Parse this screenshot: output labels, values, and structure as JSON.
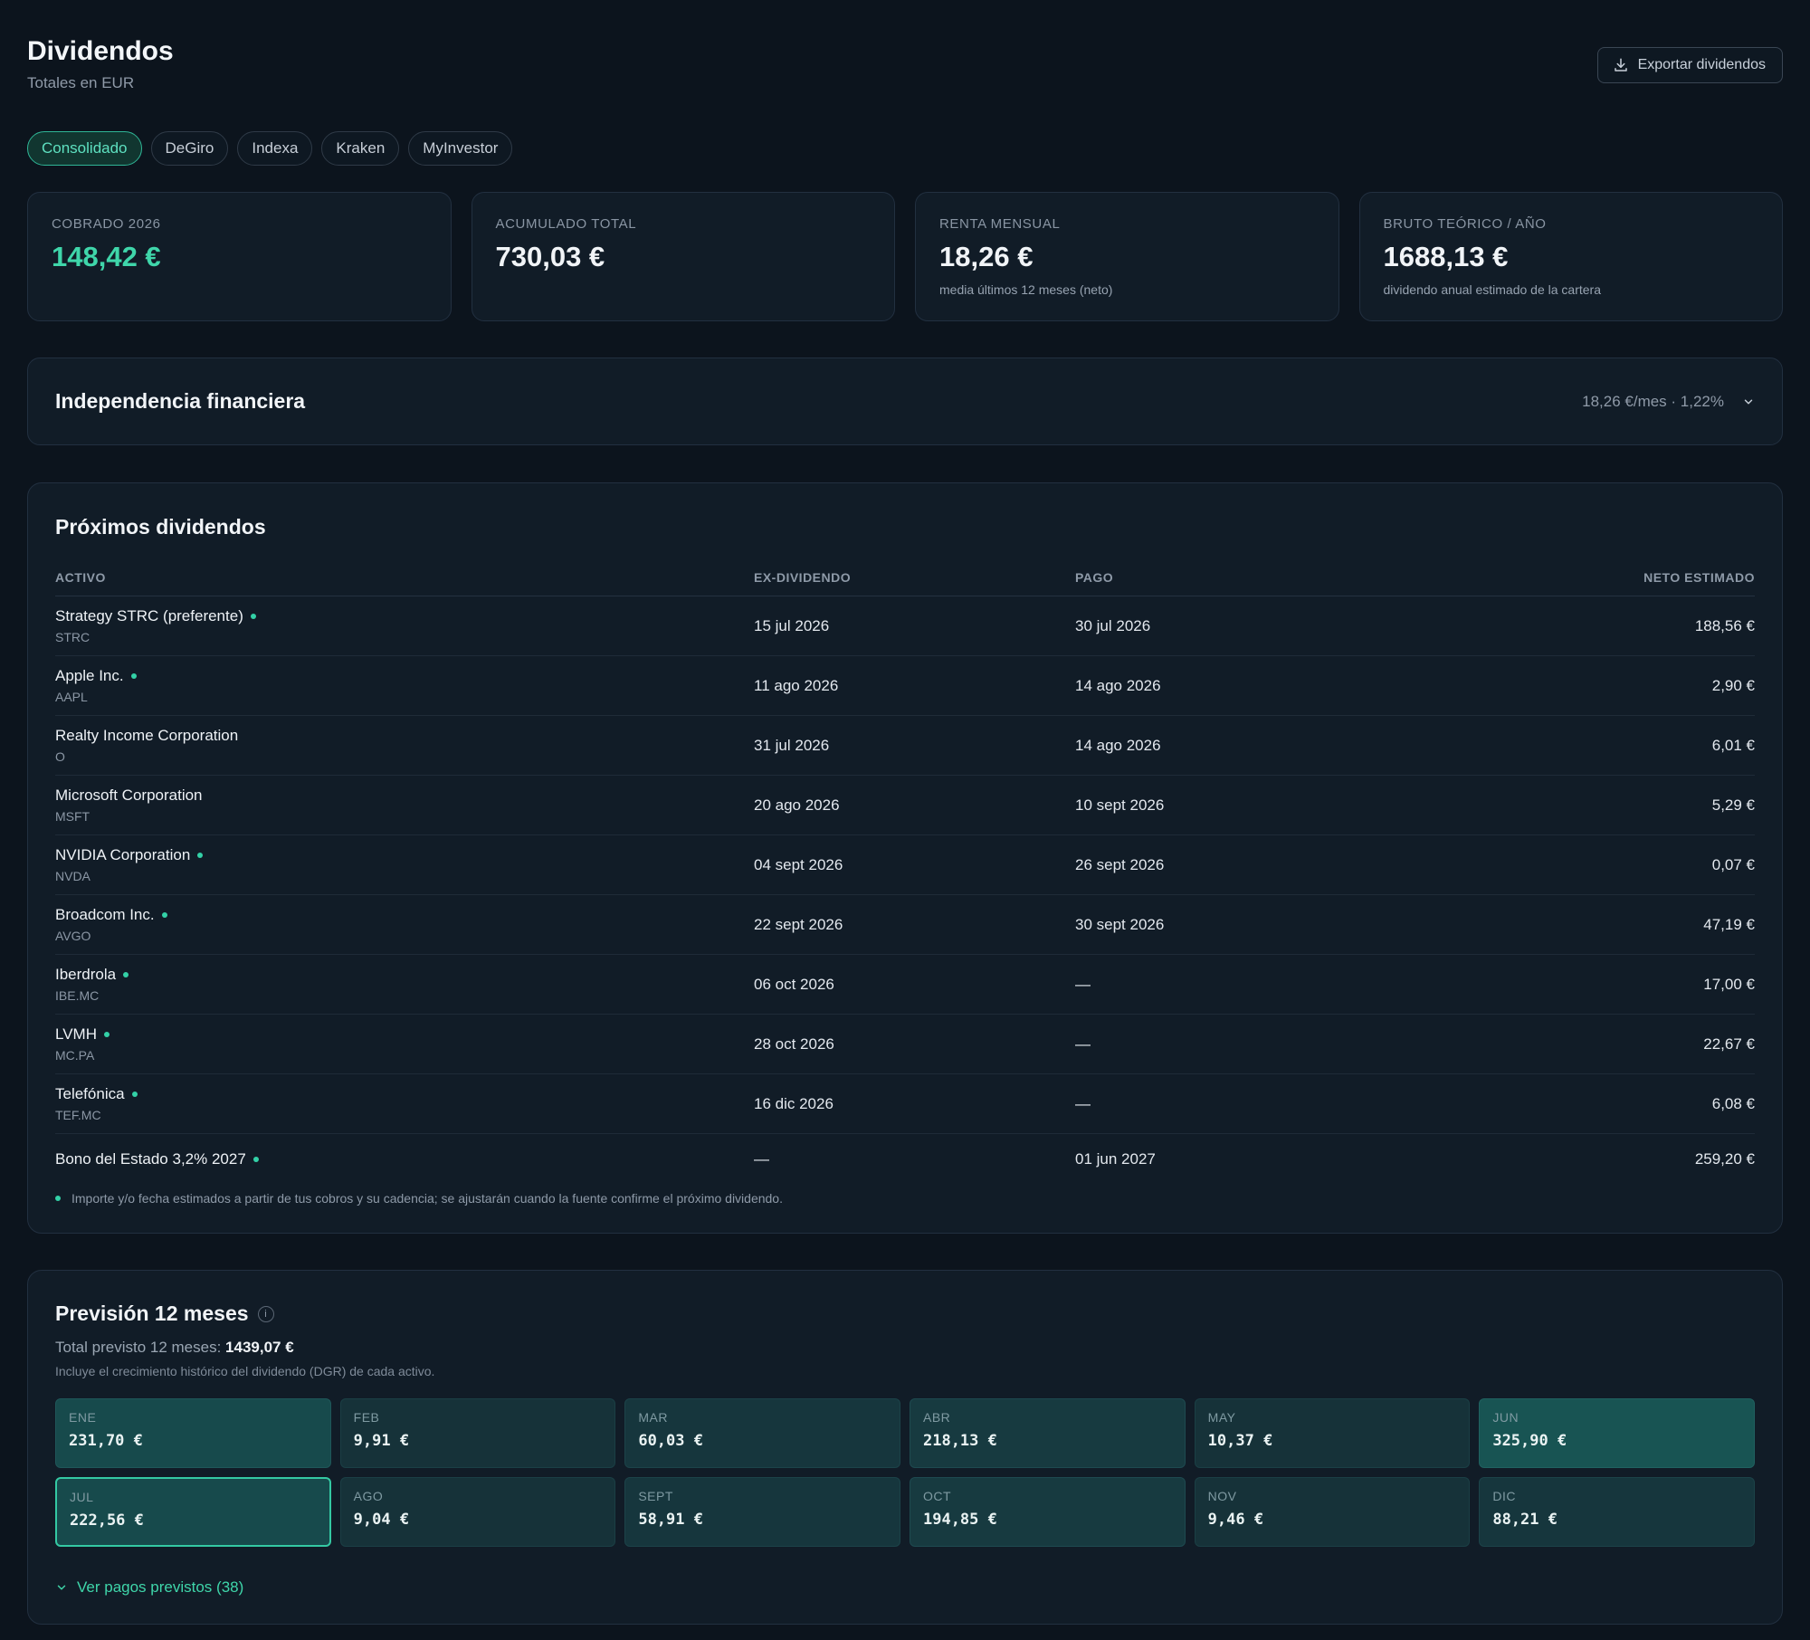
{
  "header": {
    "title": "Dividendos",
    "subtitle": "Totales en EUR",
    "export_label": "Exportar dividendos"
  },
  "tabs": [
    {
      "label": "Consolidado",
      "active": true
    },
    {
      "label": "DeGiro",
      "active": false
    },
    {
      "label": "Indexa",
      "active": false
    },
    {
      "label": "Kraken",
      "active": false
    },
    {
      "label": "MyInvestor",
      "active": false
    }
  ],
  "kpis": [
    {
      "label": "COBRADO 2026",
      "value": "148,42 €",
      "note": ""
    },
    {
      "label": "ACUMULADO TOTAL",
      "value": "730,03 €",
      "note": ""
    },
    {
      "label": "RENTA MENSUAL",
      "value": "18,26 €",
      "note": "media últimos 12 meses (neto)"
    },
    {
      "label": "BRUTO TEÓRICO / AÑO",
      "value": "1688,13 €",
      "note": "dividendo anual estimado de la cartera"
    }
  ],
  "fi": {
    "title": "Independencia financiera",
    "summary": "18,26 €/mes · 1,22%"
  },
  "upcoming": {
    "title": "Próximos dividendos",
    "columns": [
      "ACTIVO",
      "EX-DIVIDENDO",
      "PAGO",
      "NETO ESTIMADO"
    ],
    "rows": [
      {
        "name": "Strategy STRC (preferente)",
        "ticker": "STRC",
        "ex": "15 jul 2026",
        "pay": "30 jul 2026",
        "net": "188,56 €",
        "estimated": true
      },
      {
        "name": "Apple Inc.",
        "ticker": "AAPL",
        "ex": "11 ago 2026",
        "pay": "14 ago 2026",
        "net": "2,90 €",
        "estimated": true
      },
      {
        "name": "Realty Income Corporation",
        "ticker": "O",
        "ex": "31 jul 2026",
        "pay": "14 ago 2026",
        "net": "6,01 €",
        "estimated": false
      },
      {
        "name": "Microsoft Corporation",
        "ticker": "MSFT",
        "ex": "20 ago 2026",
        "pay": "10 sept 2026",
        "net": "5,29 €",
        "estimated": false
      },
      {
        "name": "NVIDIA Corporation",
        "ticker": "NVDA",
        "ex": "04 sept 2026",
        "pay": "26 sept 2026",
        "net": "0,07 €",
        "estimated": true
      },
      {
        "name": "Broadcom Inc.",
        "ticker": "AVGO",
        "ex": "22 sept 2026",
        "pay": "30 sept 2026",
        "net": "47,19 €",
        "estimated": true
      },
      {
        "name": "Iberdrola",
        "ticker": "IBE.MC",
        "ex": "06 oct 2026",
        "pay": "—",
        "net": "17,00 €",
        "estimated": true
      },
      {
        "name": "LVMH",
        "ticker": "MC.PA",
        "ex": "28 oct 2026",
        "pay": "—",
        "net": "22,67 €",
        "estimated": true
      },
      {
        "name": "Telefónica",
        "ticker": "TEF.MC",
        "ex": "16 dic 2026",
        "pay": "—",
        "net": "6,08 €",
        "estimated": true
      },
      {
        "name": "Bono del Estado 3,2% 2027",
        "ticker": "",
        "ex": "—",
        "pay": "01 jun 2027",
        "net": "259,20 €",
        "estimated": true
      }
    ],
    "note": "Importe y/o fecha estimados a partir de tus cobros y su cadencia; se ajustarán cuando la fuente confirme el próximo dividendo."
  },
  "forecast": {
    "title": "Previsión 12 meses",
    "info_icon": "i",
    "total_prefix": "Total previsto 12 meses:",
    "total_value": "1439,07 €",
    "dgr_note": "Incluye el crecimiento histórico del dividendo (DGR) de cada activo.",
    "months": [
      {
        "label": "ENE",
        "value": "231,70 €"
      },
      {
        "label": "FEB",
        "value": "9,91 €"
      },
      {
        "label": "MAR",
        "value": "60,03 €"
      },
      {
        "label": "ABR",
        "value": "218,13 €"
      },
      {
        "label": "MAY",
        "value": "10,37 €"
      },
      {
        "label": "JUN",
        "value": "325,90 €"
      },
      {
        "label": "JUL",
        "value": "222,56 €"
      },
      {
        "label": "AGO",
        "value": "9,04 €"
      },
      {
        "label": "SEPT",
        "value": "58,91 €"
      },
      {
        "label": "OCT",
        "value": "194,85 €"
      },
      {
        "label": "NOV",
        "value": "9,46 €"
      },
      {
        "label": "DIC",
        "value": "88,21 €"
      }
    ],
    "current_month": "JUL",
    "show_payments": "Ver pagos previstos (38)"
  },
  "colors": {
    "background": "#0c141d",
    "card": "#111c27",
    "accent": "#3fd6aa"
  },
  "icons": [
    "download-icon",
    "chevron-down-icon",
    "info-icon",
    "estimated-dot-icon"
  ]
}
